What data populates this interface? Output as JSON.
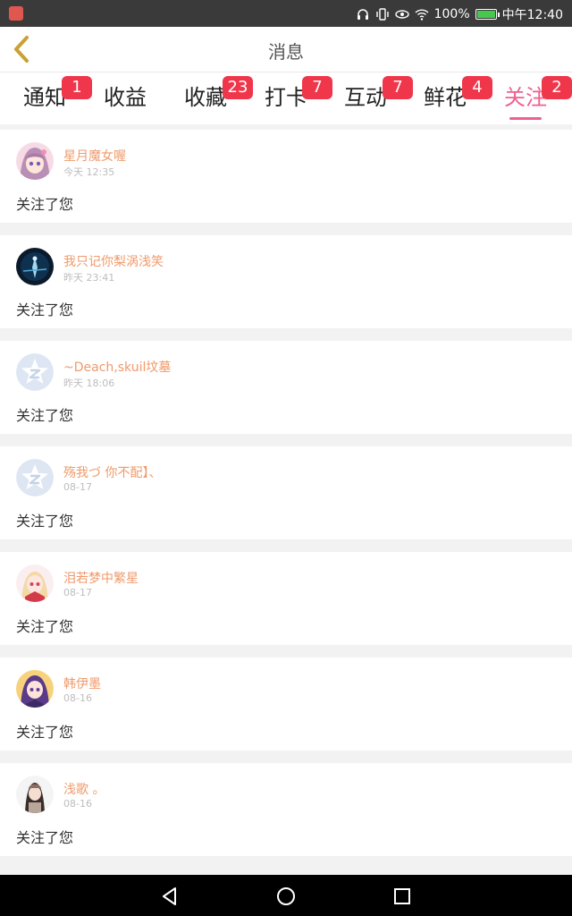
{
  "status_bar": {
    "battery": "100%",
    "time": "中午12:40",
    "icons": [
      "headphone-icon",
      "vibrate-icon",
      "eye-icon",
      "wifi-icon",
      "battery-icon"
    ]
  },
  "header": {
    "title": "消息"
  },
  "tabs": [
    {
      "label": "通知",
      "badge": "1"
    },
    {
      "label": "收益",
      "badge": ""
    },
    {
      "label": "收藏",
      "badge": "23"
    },
    {
      "label": "打卡",
      "badge": "7"
    },
    {
      "label": "互动",
      "badge": "7"
    },
    {
      "label": "鲜花",
      "badge": "4"
    },
    {
      "label": "关注",
      "badge": "2",
      "active": true
    }
  ],
  "notifications": [
    {
      "name": "星月魔女喔",
      "time": "今天 12:35",
      "message": "关注了您",
      "avatar": "anime-girl-pink"
    },
    {
      "name": "我只记你梨涡浅笑",
      "time": "昨天 23:41",
      "message": "关注了您",
      "avatar": "night-figure"
    },
    {
      "name": "~Deach,skuil坟墓",
      "time": "昨天 18:06",
      "message": "关注了您",
      "avatar": "default-star"
    },
    {
      "name": "殇我づ 你不配】、",
      "time": "08-17",
      "message": "关注了您",
      "avatar": "default-star"
    },
    {
      "name": "泪若梦中繁星",
      "time": "08-17",
      "message": "关注了您",
      "avatar": "anime-girl-red"
    },
    {
      "name": "韩伊墨",
      "time": "08-16",
      "message": "关注了您",
      "avatar": "anime-girl-purple"
    },
    {
      "name": "浅歌 。",
      "time": "08-16",
      "message": "关注了您",
      "avatar": "anime-girl-dark"
    }
  ],
  "colors": {
    "accent": "#ef5f8f",
    "badge": "#f0364b",
    "username": "#ef9a6b",
    "back_arrow": "#c8a233"
  }
}
